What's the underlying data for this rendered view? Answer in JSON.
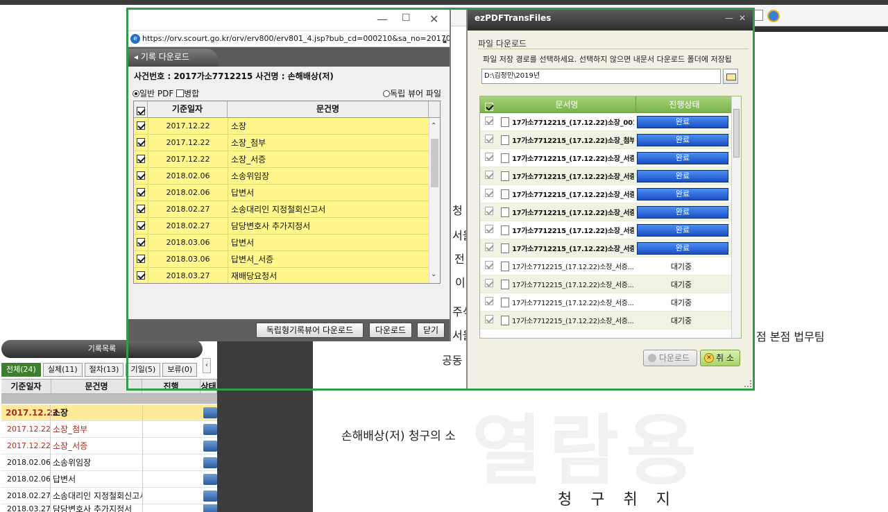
{
  "popup_record": {
    "url": "https://orv.scourt.go.kr/orv/erv800/erv801_4.jsp?bub_cd=000210&sa_no=20170037",
    "header_tab": "기록 다운로드",
    "case_info": "사건번호 : 2017가소7712215     사건명 : 손해배상(저)",
    "option_pdf": "일반 PDF",
    "option_merge": "병합",
    "option_viewer": "독립 뷰어 파일",
    "columns": {
      "date": "기준일자",
      "name": "문건명"
    },
    "rows": [
      {
        "date": "2017.12.22",
        "name": "소장"
      },
      {
        "date": "2017.12.22",
        "name": "소장_첨부"
      },
      {
        "date": "2017.12.22",
        "name": "소장_서증"
      },
      {
        "date": "2018.02.06",
        "name": "소송위임장"
      },
      {
        "date": "2018.02.06",
        "name": "답변서"
      },
      {
        "date": "2018.02.27",
        "name": "소송대리인 지정철회신고서"
      },
      {
        "date": "2018.02.27",
        "name": "담당변호사 추가지정서"
      },
      {
        "date": "2018.03.06",
        "name": "답변서"
      },
      {
        "date": "2018.03.06",
        "name": "답변서_서증"
      },
      {
        "date": "2018.03.27",
        "name": "재배당요청서"
      }
    ],
    "buttons": {
      "viewer_download": "독립형기록뷰어 다운로드",
      "download": "다운로드",
      "close": "닫기"
    }
  },
  "popup_ezpdf": {
    "title": "ezPDFTransFiles",
    "section": "파일 다운로드",
    "description": "파일 저장 경로를 선택하세요. 선택하지 않으면 내문서 다운로드 폴더에 저장됩",
    "path": "D:\\김정민\\2019년",
    "columns": {
      "name": "문서명",
      "status": "진행상태"
    },
    "files": [
      {
        "name": "17가소7712215_(17.12.22)소장_001001...",
        "status": "완료"
      },
      {
        "name": "17가소7712215_(17.12.22)소장_첨부...",
        "status": "완료"
      },
      {
        "name": "17가소7712215_(17.12.22)소장_서증...",
        "status": "완료"
      },
      {
        "name": "17가소7712215_(17.12.22)소장_서증...",
        "status": "완료"
      },
      {
        "name": "17가소7712215_(17.12.22)소장_서증...",
        "status": "완료"
      },
      {
        "name": "17가소7712215_(17.12.22)소장_서증...",
        "status": "완료"
      },
      {
        "name": "17가소7712215_(17.12.22)소장_서증...",
        "status": "완료"
      },
      {
        "name": "17가소7712215_(17.12.22)소장_서증...",
        "status": "완료"
      },
      {
        "name": "17가소7712215_(17.12.22)소장_서증...",
        "status": "대기중"
      },
      {
        "name": "17가소7712215_(17.12.22)소장_서증...",
        "status": "대기중"
      },
      {
        "name": "17가소7712215_(17.12.22)소장_서증...",
        "status": "대기중"
      },
      {
        "name": "17가소7712215_(17.12.22)소장_서증...",
        "status": "대기중"
      }
    ],
    "buttons": {
      "download": "다운로드",
      "cancel": "취 소"
    }
  },
  "record_list": {
    "title": "기록목록",
    "tabs": [
      "전체(24)",
      "실체(11)",
      "절차(13)",
      "기일(5)",
      "보류(0)"
    ],
    "columns": [
      "기준일자",
      "문건명",
      "진행",
      "상태"
    ],
    "rows": [
      {
        "date": "2017.12.22",
        "name": "소장"
      },
      {
        "date": "2017.12.22",
        "name": "소장_첨부"
      },
      {
        "date": "2017.12.22",
        "name": "소장_서증"
      },
      {
        "date": "2018.02.06",
        "name": "소송위임장"
      },
      {
        "date": "2018.02.06",
        "name": "답변서"
      },
      {
        "date": "2018.02.27",
        "name": "소송대리인 지정철회신고서"
      },
      {
        "date": "2018.03.27",
        "name": "담당변호사 추가지정서"
      }
    ]
  },
  "document": {
    "side_chars": [
      "청",
      "서울",
      "전",
      "이",
      "주식",
      "서울",
      "공동"
    ],
    "firm_text": "점 본점 법무팀",
    "claim_title": "손해배상(저) 청구의 소",
    "claim_heading": "청 구 취 지",
    "watermark": "열람용"
  }
}
